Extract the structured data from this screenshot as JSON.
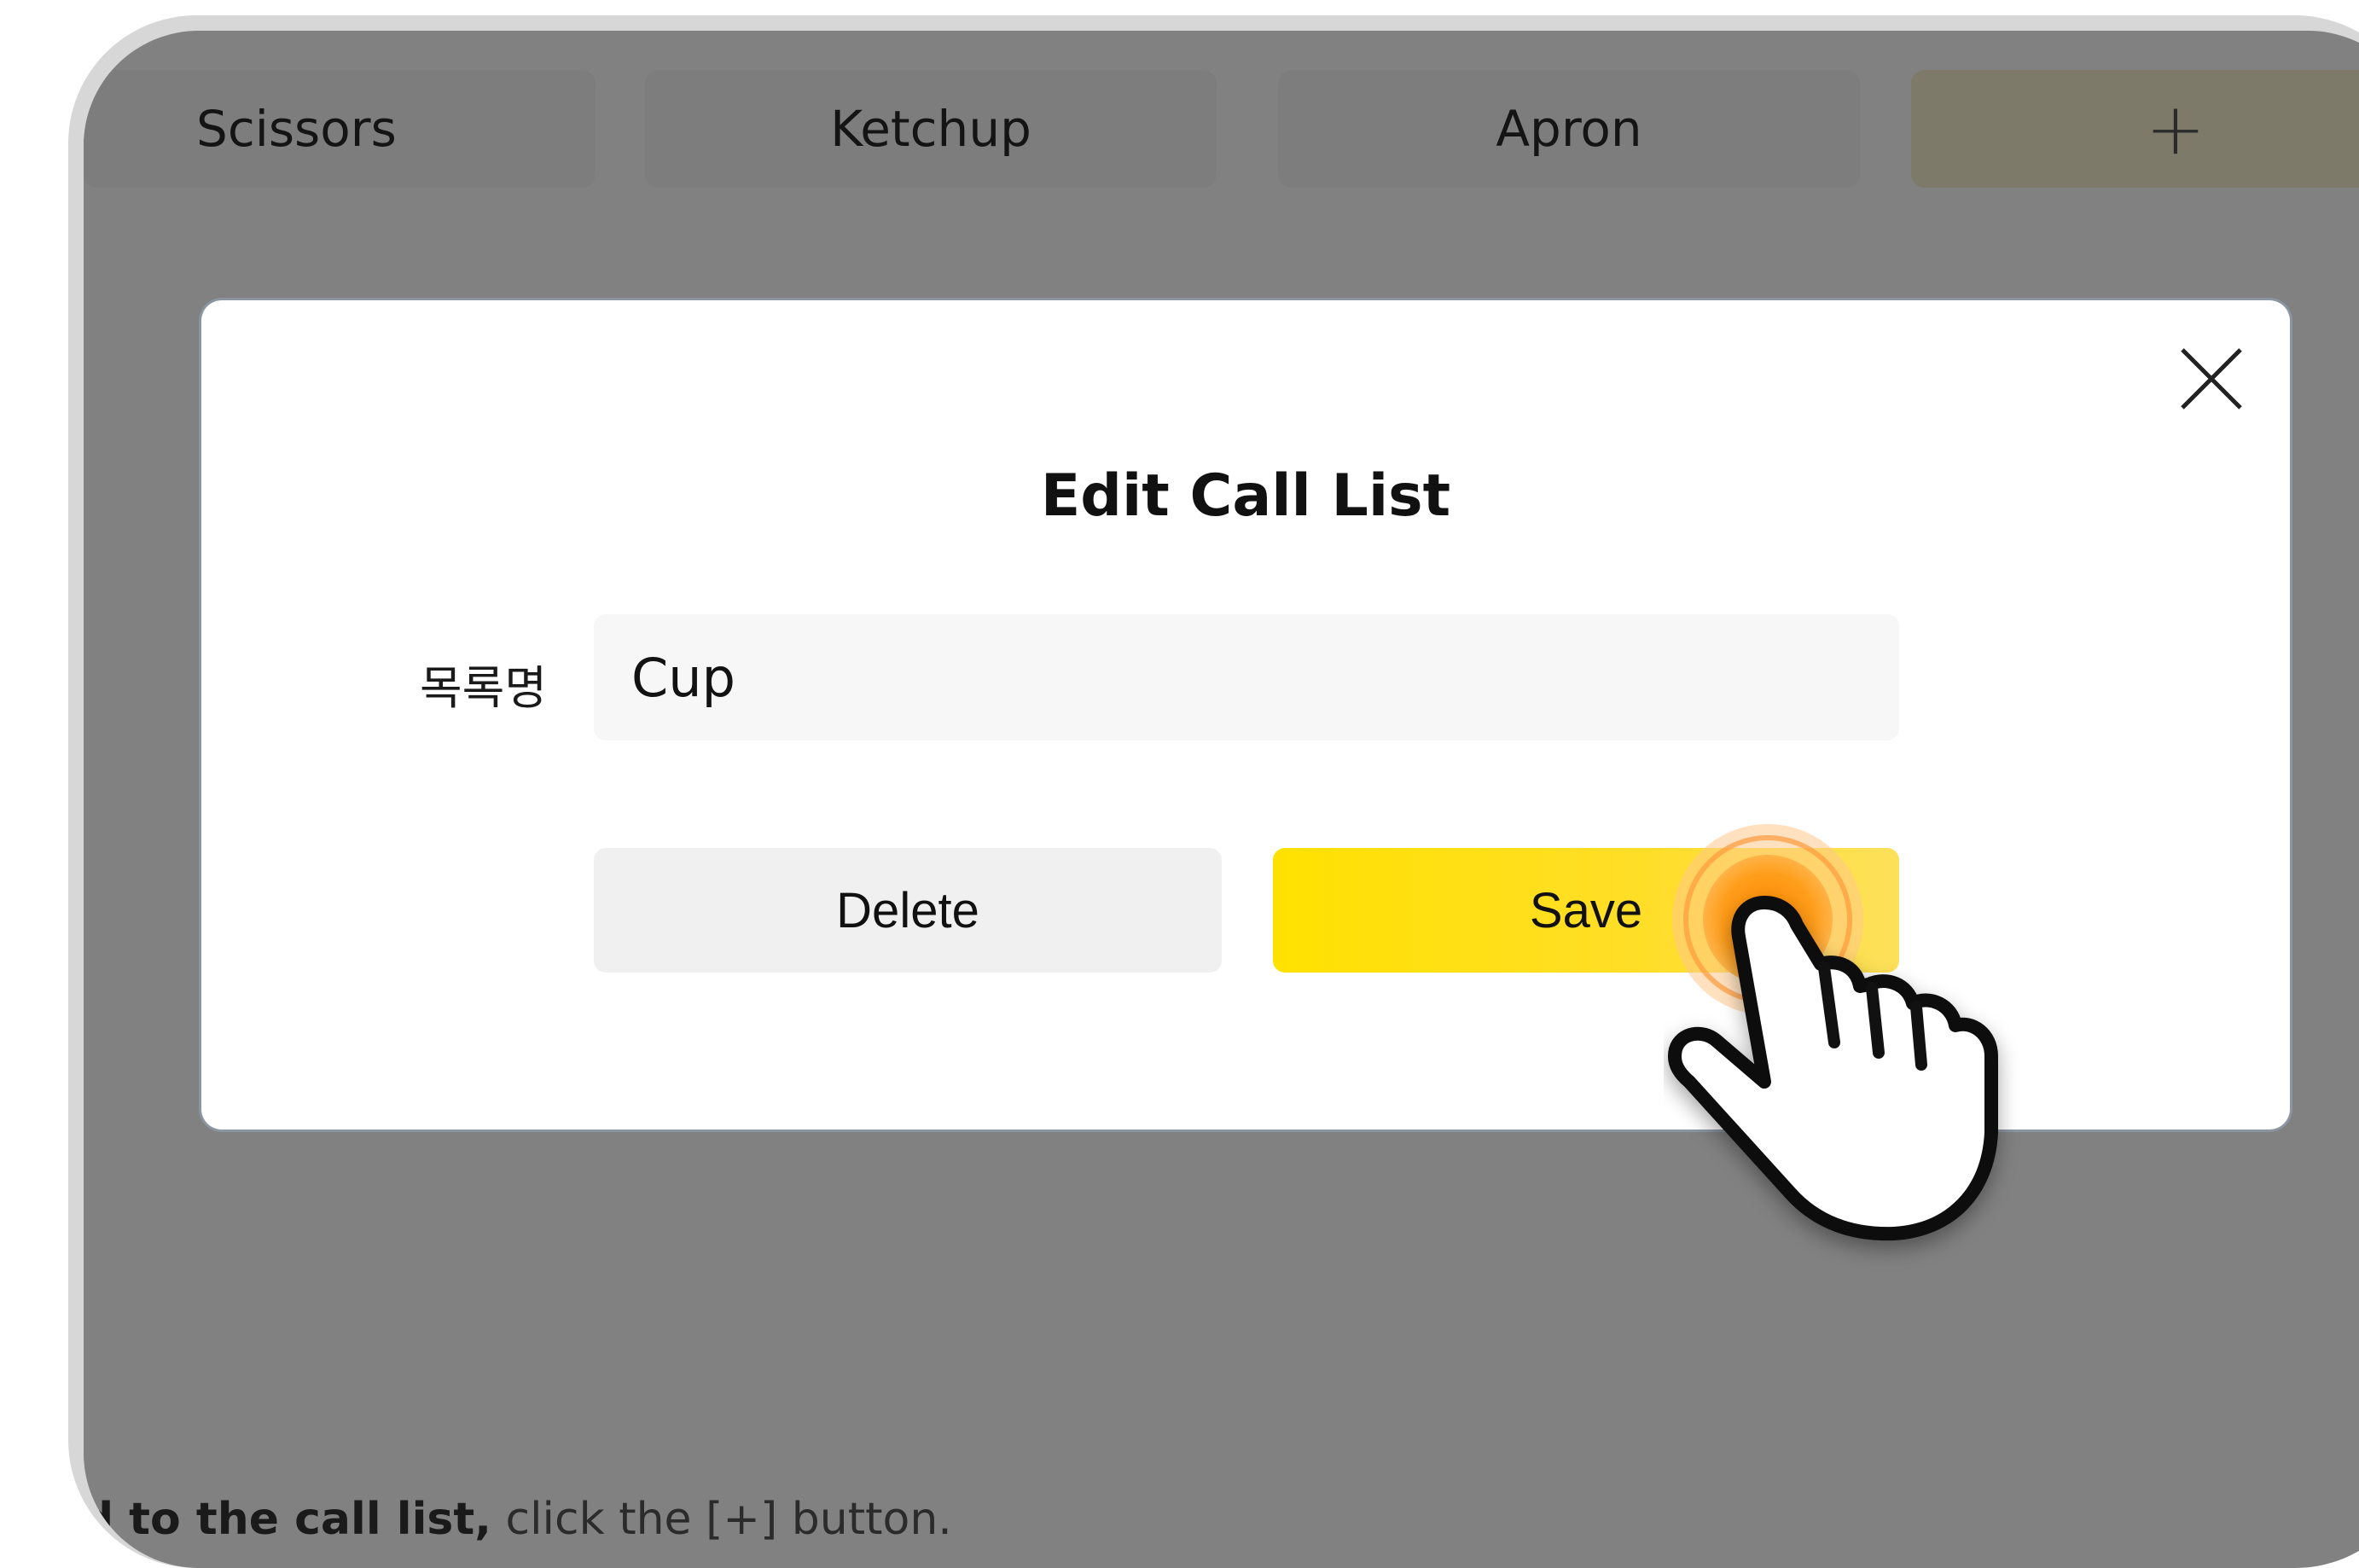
{
  "tabs": [
    {
      "label": "Scissors"
    },
    {
      "label": "Ketchup"
    },
    {
      "label": "Apron"
    },
    {
      "label": "+"
    }
  ],
  "modal": {
    "title": "Edit Call List",
    "field_label": "목록명",
    "field_value": "Cup",
    "delete_label": "Delete",
    "save_label": "Save",
    "close_icon": "close-icon"
  },
  "hint": {
    "strong": "ld to the call list,",
    "rest": " click the [+] button."
  },
  "colors": {
    "overlay": "#818181",
    "save_button": "#ffe100",
    "delete_button": "#f0f0f0",
    "tap_indicator": "#ff9a1f"
  },
  "icons": {
    "pointer": "hand-pointer-icon",
    "tap": "tap-ripple-icon"
  }
}
